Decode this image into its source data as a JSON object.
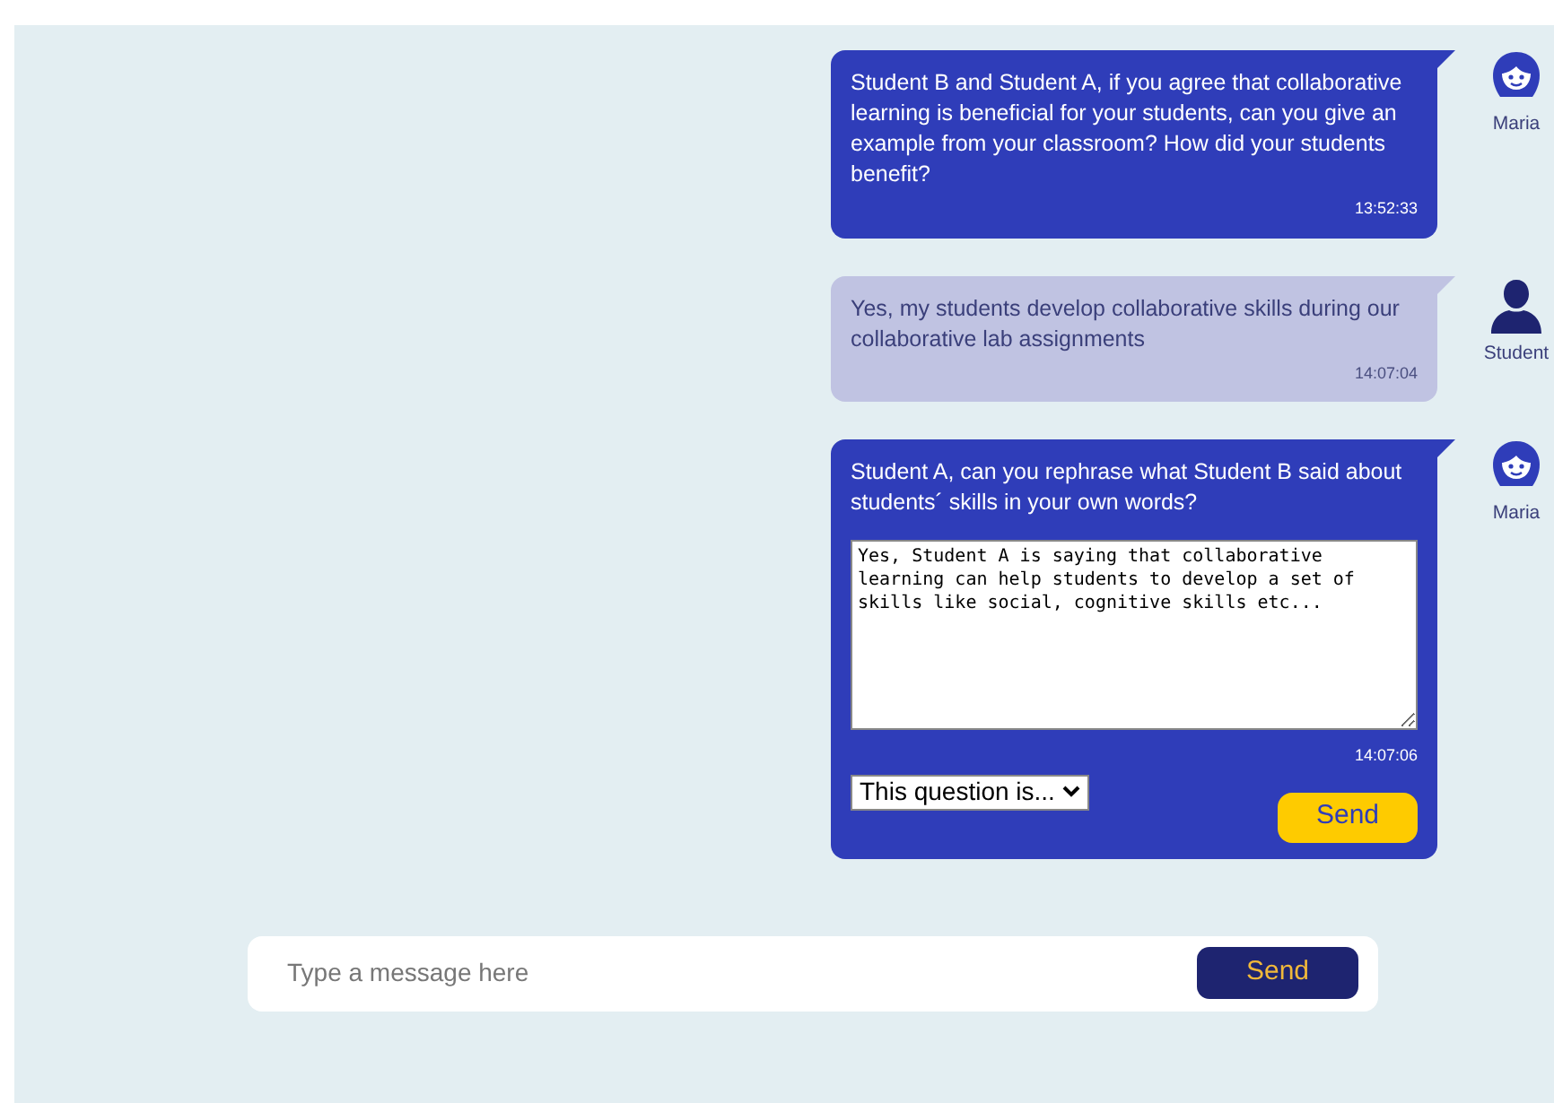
{
  "messages": [
    {
      "kind": "question",
      "text": "Student B and Student A, if you agree that collaborative learning is beneficial for your students, can you give an example from your classroom? How did your students benefit?",
      "time": "13:52:33",
      "author": {
        "kind": "female",
        "name": "Maria"
      }
    },
    {
      "kind": "answer",
      "text": "Yes, my students develop collaborative skills during our collaborative lab assignments",
      "time": "14:07:04",
      "author": {
        "kind": "person",
        "name": "Student"
      }
    },
    {
      "kind": "prompt",
      "text": "Student A, can you rephrase what Student B said about students´ skills in your own words?",
      "reply": "Yes, Student A is saying that collaborative learning can help students to develop a set of skills like social, cognitive skills etc...",
      "time": "14:07:06",
      "select": "This question is...",
      "button": "Send",
      "author": {
        "kind": "female",
        "name": "Maria"
      }
    }
  ],
  "composer": {
    "placeholder": "Type a message here",
    "button": "Send"
  }
}
